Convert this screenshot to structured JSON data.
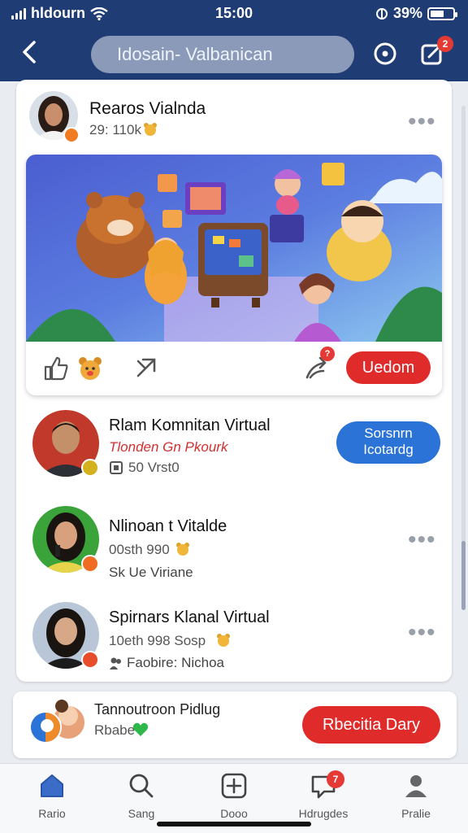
{
  "status_bar": {
    "carrier": "hldourn",
    "time": "15:00",
    "battery": "39%"
  },
  "header": {
    "title": "Idosain- Valbanican",
    "notification_count": "2"
  },
  "post": {
    "author": "Rearos Vialnda",
    "meta": "29: 110k",
    "action_label": "Uedom",
    "share_badge": "?"
  },
  "suggestions": [
    {
      "name": "Rlam Komnitan Virtual",
      "subtitle": "Tlonden Gn Pkourk",
      "meta": "50 Vrst0",
      "button_label_line1": "Sorsnrn",
      "button_label_line2": "Icotardg"
    },
    {
      "name": "Nlinoan t Vitalde",
      "meta": "00sth 990",
      "meta2": "Sk Ue Viriane"
    },
    {
      "name": "Spirnars Klanal Virtual",
      "meta": "10eth 998 Sosp",
      "meta2": "Faobire: Nichoa"
    }
  ],
  "promo": {
    "title": "Tannoutroon Pidlug",
    "subtitle": "Rbabe",
    "button_label": "Rbecitia Dary"
  },
  "tabs": [
    {
      "label": "Rario"
    },
    {
      "label": "Sang"
    },
    {
      "label": "Dooo"
    },
    {
      "label": "Hdrugdes",
      "badge": "7"
    },
    {
      "label": "Pralie"
    }
  ],
  "colors": {
    "header": "#1f3d74",
    "accent_red": "#e02b2b",
    "accent_blue": "#2b73d6"
  }
}
